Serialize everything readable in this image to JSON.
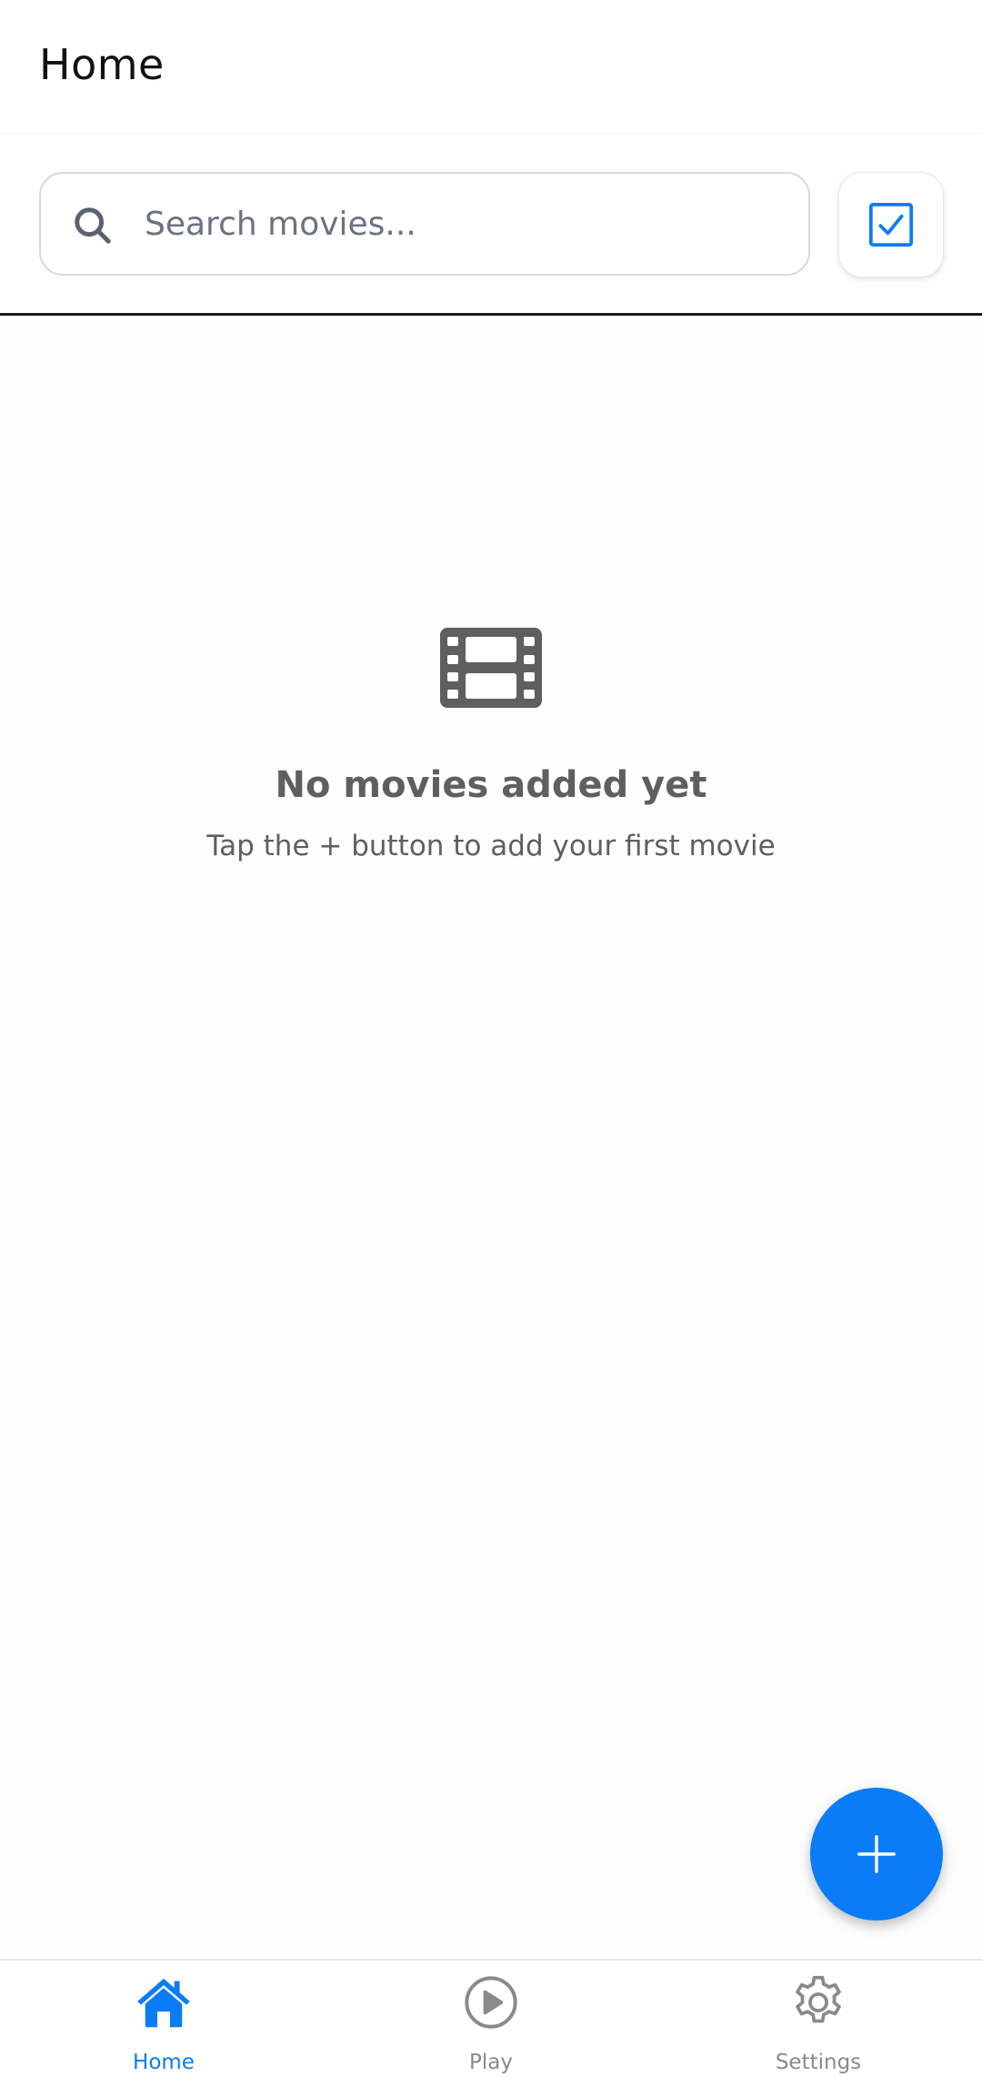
{
  "header": {
    "title": "Home"
  },
  "search": {
    "placeholder": "Search movies...",
    "value": ""
  },
  "select_button": {
    "icon": "checkbox-checked-icon"
  },
  "empty_state": {
    "icon": "film-icon",
    "title": "No movies added yet",
    "subtitle": "Tap the + button to add your first movie"
  },
  "fab": {
    "icon": "plus-icon"
  },
  "bottom_nav": {
    "items": [
      {
        "label": "Home",
        "icon": "home-icon",
        "active": true
      },
      {
        "label": "Play",
        "icon": "play-circle-icon",
        "active": false
      },
      {
        "label": "Settings",
        "icon": "gear-icon",
        "active": false
      }
    ]
  },
  "colors": {
    "accent": "#0a7cf7",
    "inactive": "#8a8a8a",
    "empty_text": "#5f5f5f"
  }
}
